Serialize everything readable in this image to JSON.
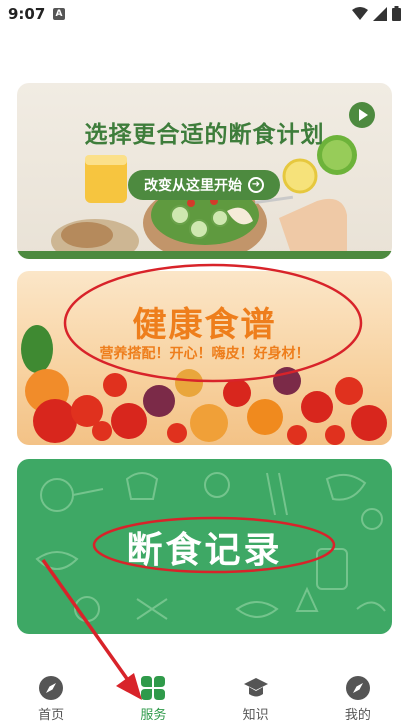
{
  "status_bar": {
    "time": "9:07",
    "notification_badge": "A"
  },
  "cards": {
    "plan": {
      "title": "选择更合适的断食计划",
      "button_label": "改变从这里开始"
    },
    "recipes": {
      "title": "健康食谱",
      "subtitle": "营养搭配！开心！嗨皮！好身材！"
    },
    "records": {
      "title": "断食记录"
    }
  },
  "bottom_nav": {
    "items": [
      {
        "label": "首页",
        "icon": "compass-icon",
        "active": false
      },
      {
        "label": "服务",
        "icon": "clover-icon",
        "active": true
      },
      {
        "label": "知识",
        "icon": "graduation-cap-icon",
        "active": false
      },
      {
        "label": "我的",
        "icon": "compass-icon",
        "active": false
      }
    ]
  },
  "colors": {
    "accent_green": "#2f9a4a",
    "annotation_red": "#d8232a",
    "orange_text": "#ee7e1c",
    "card_green": "#3ea865"
  }
}
